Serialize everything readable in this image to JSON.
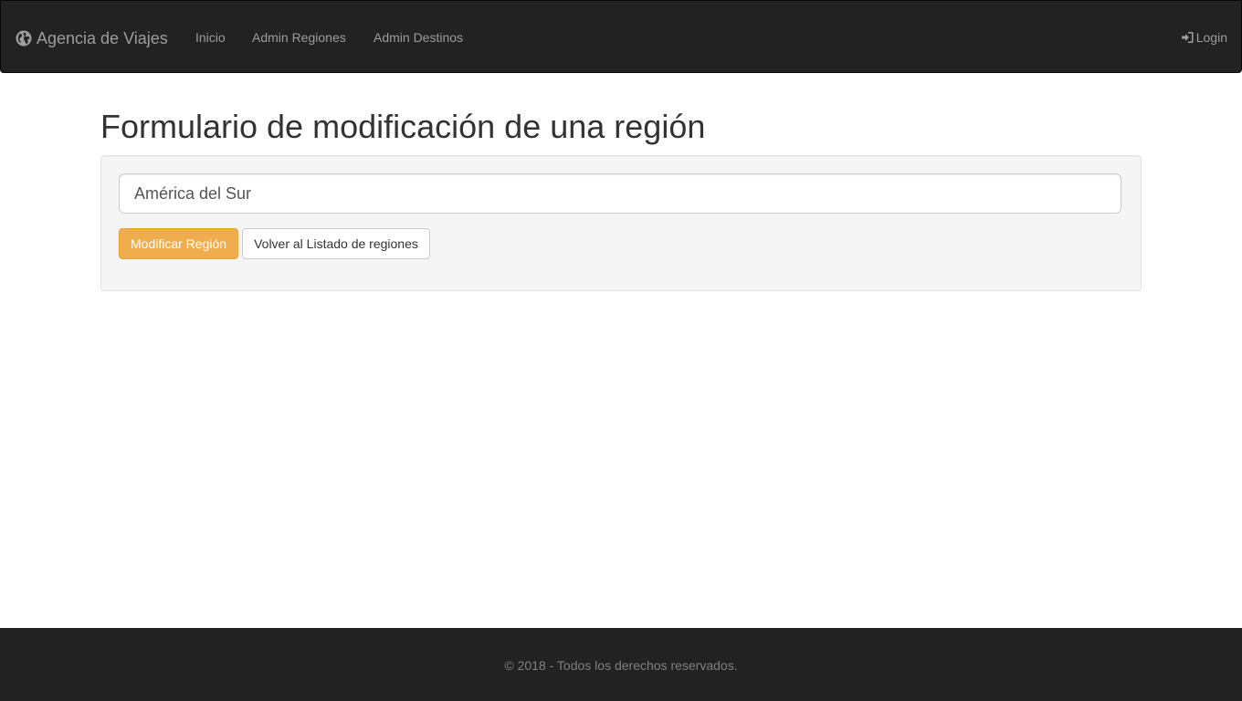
{
  "navbar": {
    "brand_icon": "globe-icon",
    "brand": "Agencia de Viajes",
    "links": [
      "Inicio",
      "Admin Regiones",
      "Admin Destinos"
    ],
    "login_icon": "log-in-icon",
    "login": "Login"
  },
  "main": {
    "title": "Formulario de modificación de una región",
    "form": {
      "region_value": "América del Sur",
      "submit_label": "Modificar Región",
      "back_label": "Volver al Listado de regiones"
    }
  },
  "footer": {
    "text": "© 2018 - Todos los derechos reservados."
  },
  "colors": {
    "navbar_bg": "#222222",
    "warning": "#f0ad4e",
    "well_bg": "#f5f5f5"
  }
}
